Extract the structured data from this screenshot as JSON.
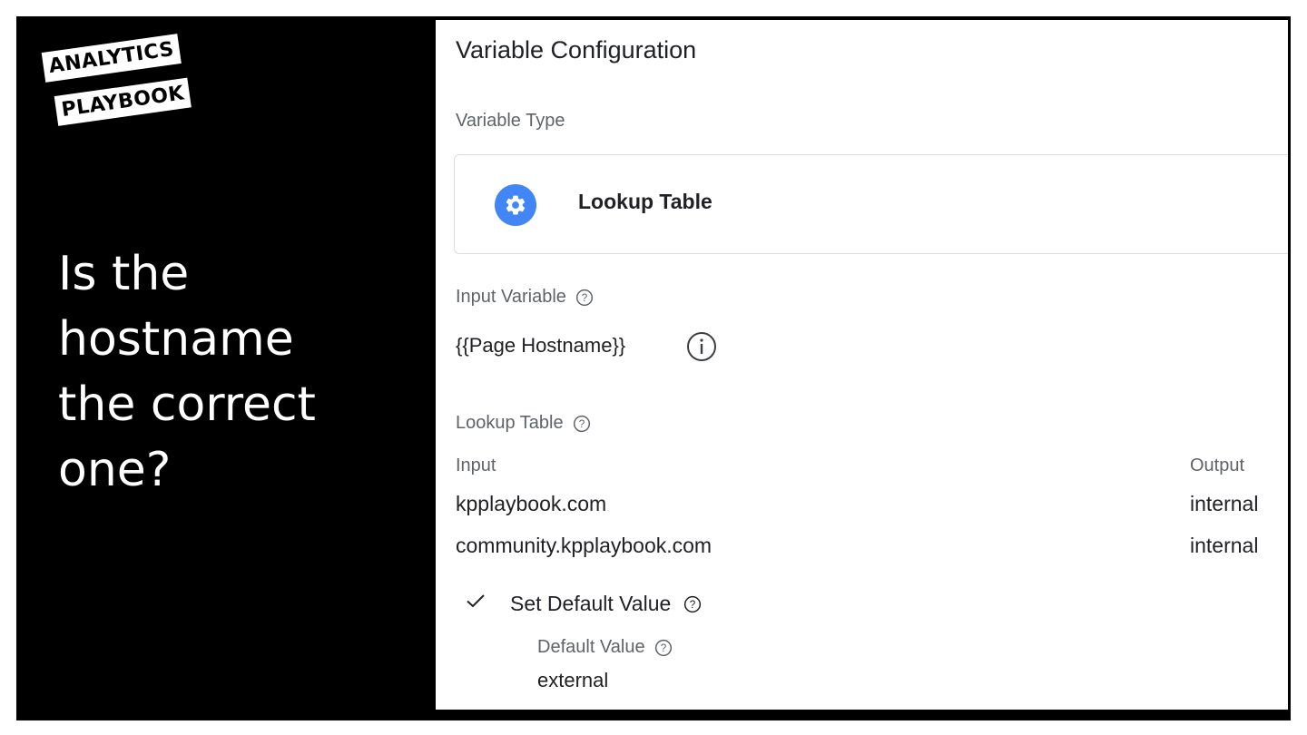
{
  "logo": {
    "line1": "ANALYTICS",
    "line2": "PLAYBOOK"
  },
  "headline": {
    "lines": [
      "Is the",
      "hostname",
      "the correct",
      "one?"
    ]
  },
  "panel": {
    "title": "Variable Configuration",
    "variable_type_label": "Variable Type",
    "variable_type": {
      "name": "Lookup Table",
      "icon": "gear-icon",
      "icon_color": "#4285f4"
    },
    "input_variable_label": "Input Variable",
    "input_variable_value": "{{Page Hostname}}",
    "lookup_table_label": "Lookup Table",
    "table": {
      "headers": {
        "input": "Input",
        "output": "Output"
      },
      "rows": [
        {
          "input": "kpplaybook.com",
          "output": "internal"
        },
        {
          "input": "community.kpplaybook.com",
          "output": "internal"
        }
      ]
    },
    "set_default": {
      "checked": true,
      "label": "Set Default Value"
    },
    "default_value_label": "Default Value",
    "default_value": "external"
  }
}
